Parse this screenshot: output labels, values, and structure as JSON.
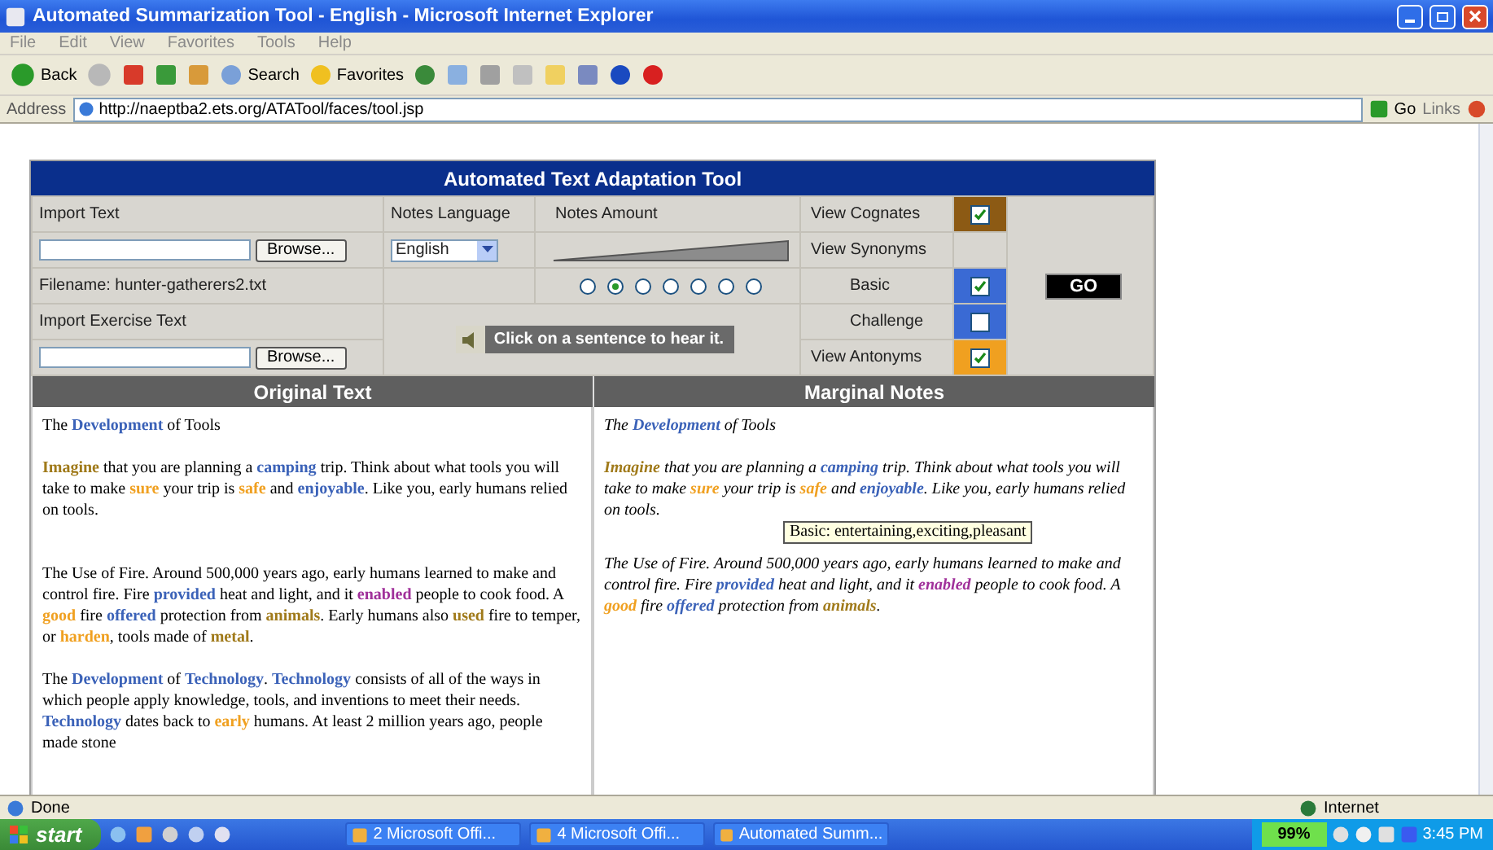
{
  "window": {
    "title": "Automated Summarization Tool - English - Microsoft Internet Explorer"
  },
  "menu": [
    "File",
    "Edit",
    "View",
    "Favorites",
    "Tools",
    "Help"
  ],
  "toolbar": {
    "back": "Back",
    "search": "Search",
    "favorites": "Favorites"
  },
  "address": {
    "label": "Address",
    "url": "http://naeptba2.ets.org/ATATool/faces/tool.jsp",
    "go": "Go",
    "links": "Links"
  },
  "tool": {
    "title": "Automated Text Adaptation Tool",
    "import_text": {
      "label": "Import Text",
      "browse": "Browse...",
      "filename": "Filename: hunter-gatherers2.txt"
    },
    "notes_language": {
      "label": "Notes Language",
      "value": "English"
    },
    "notes_amount": {
      "label": "Notes Amount",
      "options": [
        {
          "selected": false
        },
        {
          "selected": true
        },
        {
          "selected": false
        },
        {
          "selected": false
        },
        {
          "selected": false
        },
        {
          "selected": false
        },
        {
          "selected": false
        }
      ]
    },
    "views": [
      {
        "kind": "option",
        "label": "View Cognates",
        "checked": true,
        "color": "#8c5a14"
      },
      {
        "kind": "group",
        "label": "View Synonyms"
      },
      {
        "kind": "sub",
        "label": "Basic",
        "checked": true,
        "color": "#3a6ad4"
      },
      {
        "kind": "sub",
        "label": "Challenge",
        "checked": false,
        "color": "#3a6ad4"
      },
      {
        "kind": "option",
        "label": "View Antonyms",
        "checked": true,
        "color": "#f0a020"
      }
    ],
    "import_exercise": {
      "label": "Import Exercise Text",
      "browse": "Browse..."
    },
    "hint": "Click on a sentence to hear it.",
    "go": "GO"
  },
  "columns": [
    "Original Text",
    "Marginal Notes"
  ],
  "original": [
    [
      {
        "text": "The "
      },
      {
        "text": "Development",
        "color": "#3b62b8"
      },
      {
        "text": " of Tools"
      }
    ],
    [
      {
        "text": "Imagine",
        "color": "#a07a1a"
      },
      {
        "text": " that you are planning a "
      },
      {
        "text": "camping",
        "color": "#3b62b8"
      },
      {
        "text": " trip. Think about what tools you will take to make "
      },
      {
        "text": "sure",
        "color": "#f0a020"
      },
      {
        "text": " your trip is "
      },
      {
        "text": "safe",
        "color": "#f0a020"
      },
      {
        "text": " and "
      },
      {
        "text": "enjoyable",
        "color": "#3b62b8"
      },
      {
        "text": ". Like you, early humans relied on tools."
      }
    ],
    [
      {
        "text": "The Use of Fire. Around 500,000 years ago, early humans learned to make and control fire. Fire "
      },
      {
        "text": "provided",
        "color": "#3b62b8"
      },
      {
        "text": " heat and light, and it "
      },
      {
        "text": "enabled",
        "color": "#a0309a"
      },
      {
        "text": " people to cook food. A "
      },
      {
        "text": "good",
        "color": "#f0a020"
      },
      {
        "text": " fire "
      },
      {
        "text": "offered",
        "color": "#3b62b8"
      },
      {
        "text": " protection from "
      },
      {
        "text": "animals",
        "color": "#a07a1a"
      },
      {
        "text": ". Early humans also "
      },
      {
        "text": "used",
        "color": "#a07a1a"
      },
      {
        "text": " fire to temper, or "
      },
      {
        "text": "harden",
        "color": "#f0a020"
      },
      {
        "text": ", tools made of "
      },
      {
        "text": "metal",
        "color": "#a07a1a"
      },
      {
        "text": "."
      }
    ],
    [
      {
        "text": "The "
      },
      {
        "text": "Development",
        "color": "#3b62b8"
      },
      {
        "text": " of "
      },
      {
        "text": "Technology",
        "color": "#3b62b8"
      },
      {
        "text": ". "
      },
      {
        "text": "Technology",
        "color": "#3b62b8"
      },
      {
        "text": " consists of all of the ways in which people apply knowledge, tools, and inventions to meet their needs. "
      },
      {
        "text": "Technology",
        "color": "#3b62b8"
      },
      {
        "text": " dates back to "
      },
      {
        "text": "early",
        "color": "#f0a020"
      },
      {
        "text": " humans. At least 2 million years ago, people made stone"
      }
    ]
  ],
  "notes": [
    [
      {
        "text": "The "
      },
      {
        "text": "Development",
        "color": "#3b62b8"
      },
      {
        "text": " of Tools"
      }
    ],
    [
      {
        "text": "Imagine",
        "color": "#a07a1a"
      },
      {
        "text": " that you are planning a "
      },
      {
        "text": "camping",
        "color": "#3b62b8"
      },
      {
        "text": " trip. Think about what tools you will take to make "
      },
      {
        "text": "sure",
        "color": "#f0a020"
      },
      {
        "text": " your trip is "
      },
      {
        "text": "safe",
        "color": "#f0a020"
      },
      {
        "text": " and "
      },
      {
        "text": "enjoyable",
        "color": "#3b62b8"
      },
      {
        "text": ". Like you, early humans relied on tools."
      }
    ],
    [
      {
        "text": "The Use of Fire. Around 500,000 years ago, early humans learned to make and control fire. Fire "
      },
      {
        "text": "provided",
        "color": "#3b62b8"
      },
      {
        "text": " heat and light, and it "
      },
      {
        "text": "enabled",
        "color": "#a0309a"
      },
      {
        "text": " people to cook food. A "
      },
      {
        "text": "good",
        "color": "#f0a020"
      },
      {
        "text": " fire "
      },
      {
        "text": "offered",
        "color": "#3b62b8"
      },
      {
        "text": " protection from "
      },
      {
        "text": "animals",
        "color": "#a07a1a"
      },
      {
        "text": "."
      }
    ]
  ],
  "tooltip": "Basic: entertaining,exciting,pleasant",
  "status": {
    "text": "Done",
    "zone": "Internet"
  },
  "taskbar": {
    "start": "start",
    "tasks": [
      "2 Microsoft Offi...",
      "4 Microsoft Offi...",
      "Automated Summ..."
    ],
    "battery": "99%",
    "clock": "3:45 PM"
  }
}
